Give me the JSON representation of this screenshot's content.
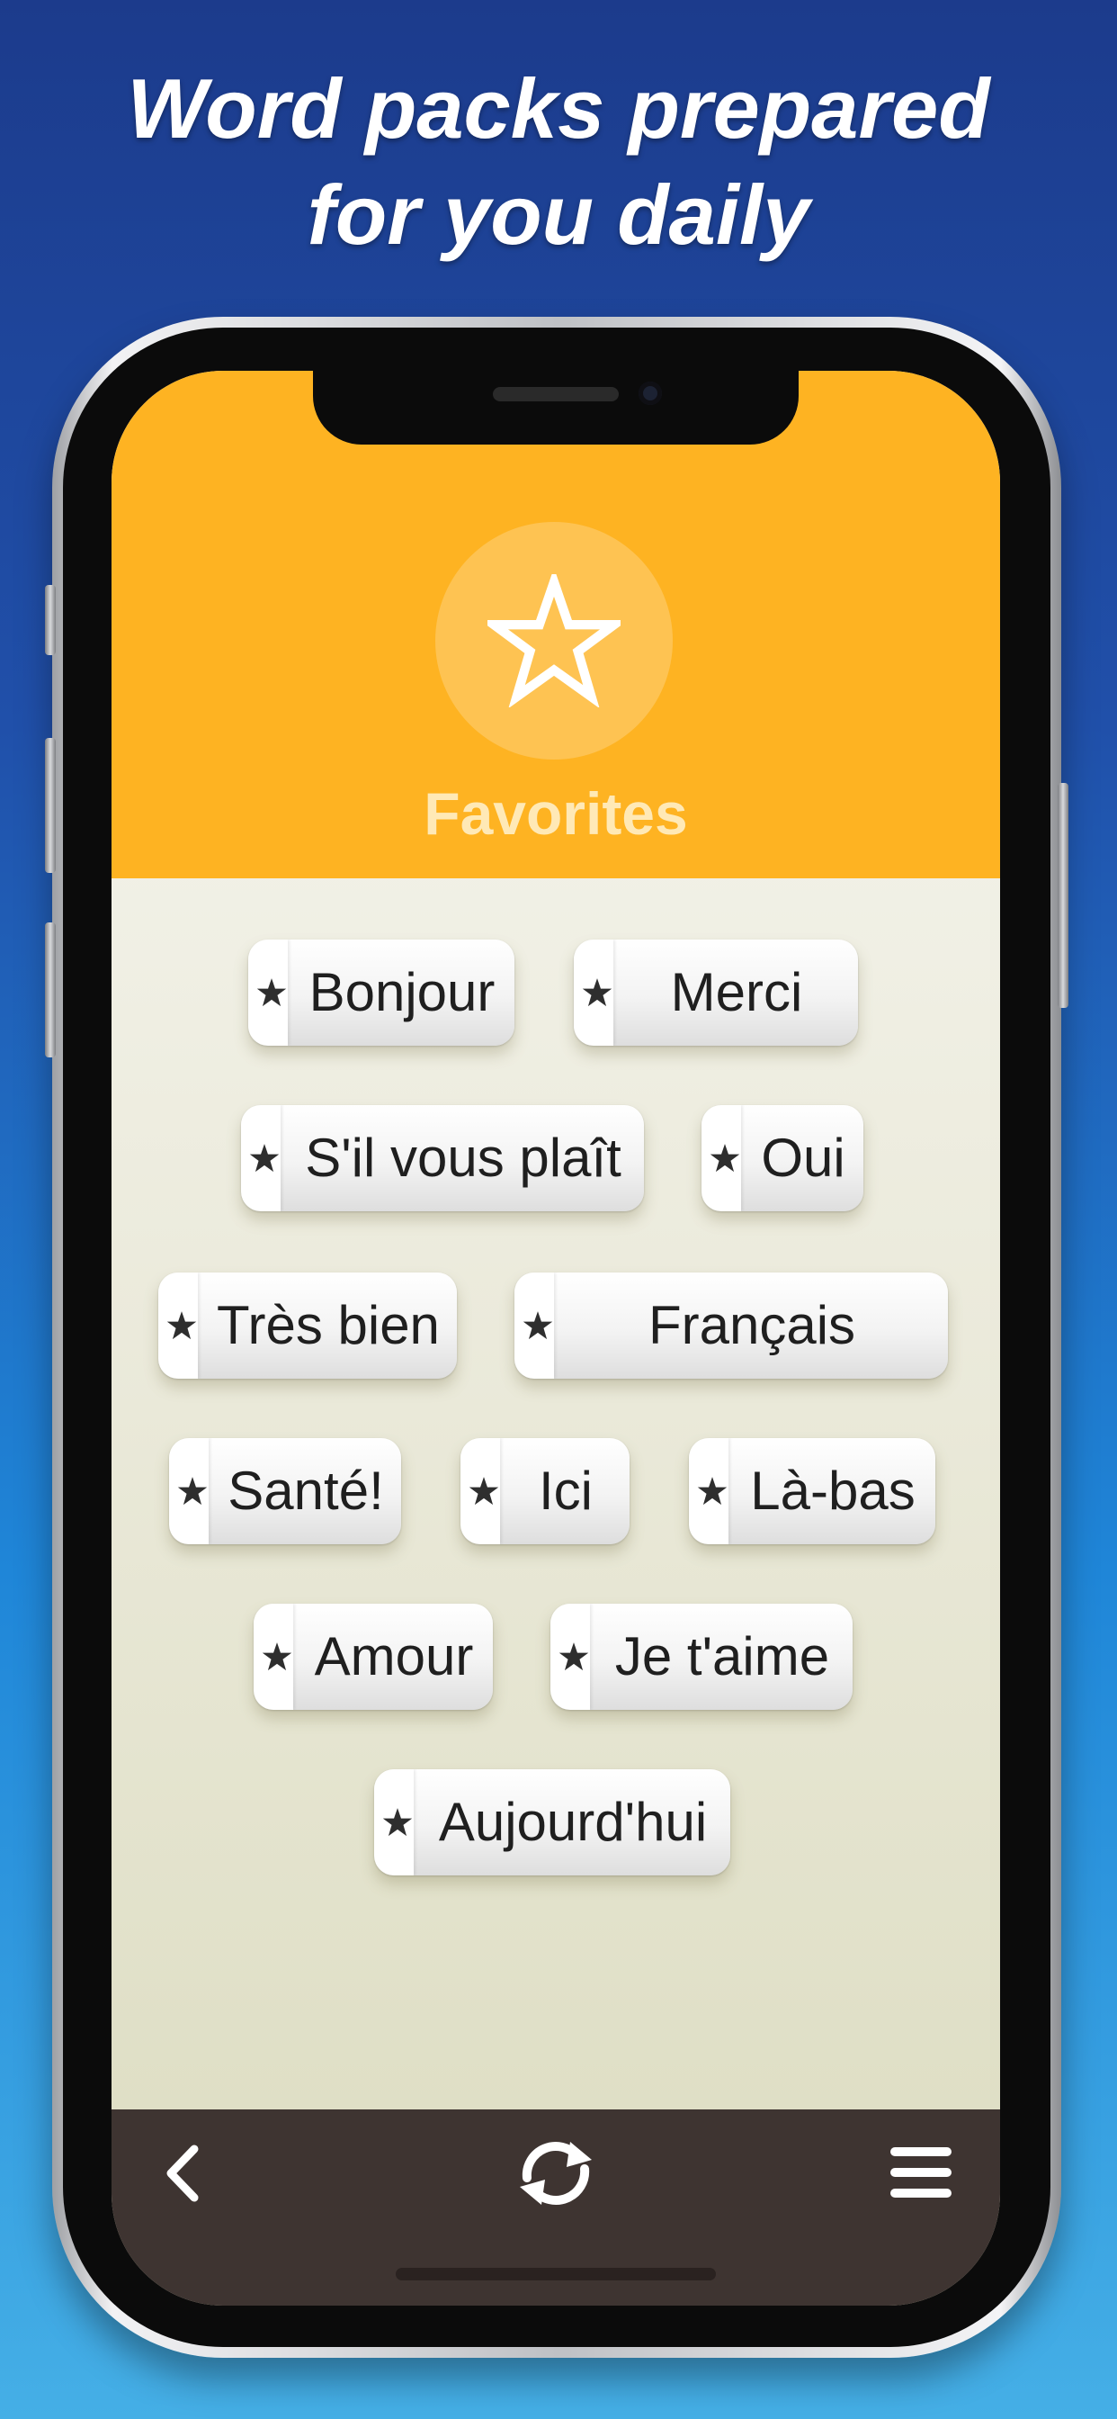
{
  "headline": {
    "line1": "Word packs prepared",
    "line2": "for you daily"
  },
  "screen": {
    "header_title": "Favorites",
    "header_icon": "star-outline-icon",
    "colors": {
      "header": "#feb322",
      "bottom_bar": "#3e3431",
      "pill_text": "#1f1f1f"
    },
    "words": [
      "Bonjour",
      "Merci",
      "S'il vous plaît",
      "Oui",
      "Très bien",
      "Français",
      "Santé!",
      "Ici",
      "Là-bas",
      "Amour",
      "Je t'aime",
      "Aujourd'hui"
    ],
    "bottom_nav": {
      "back_icon": "chevron-left-icon",
      "refresh_icon": "refresh-icon",
      "menu_icon": "hamburger-menu-icon"
    }
  }
}
